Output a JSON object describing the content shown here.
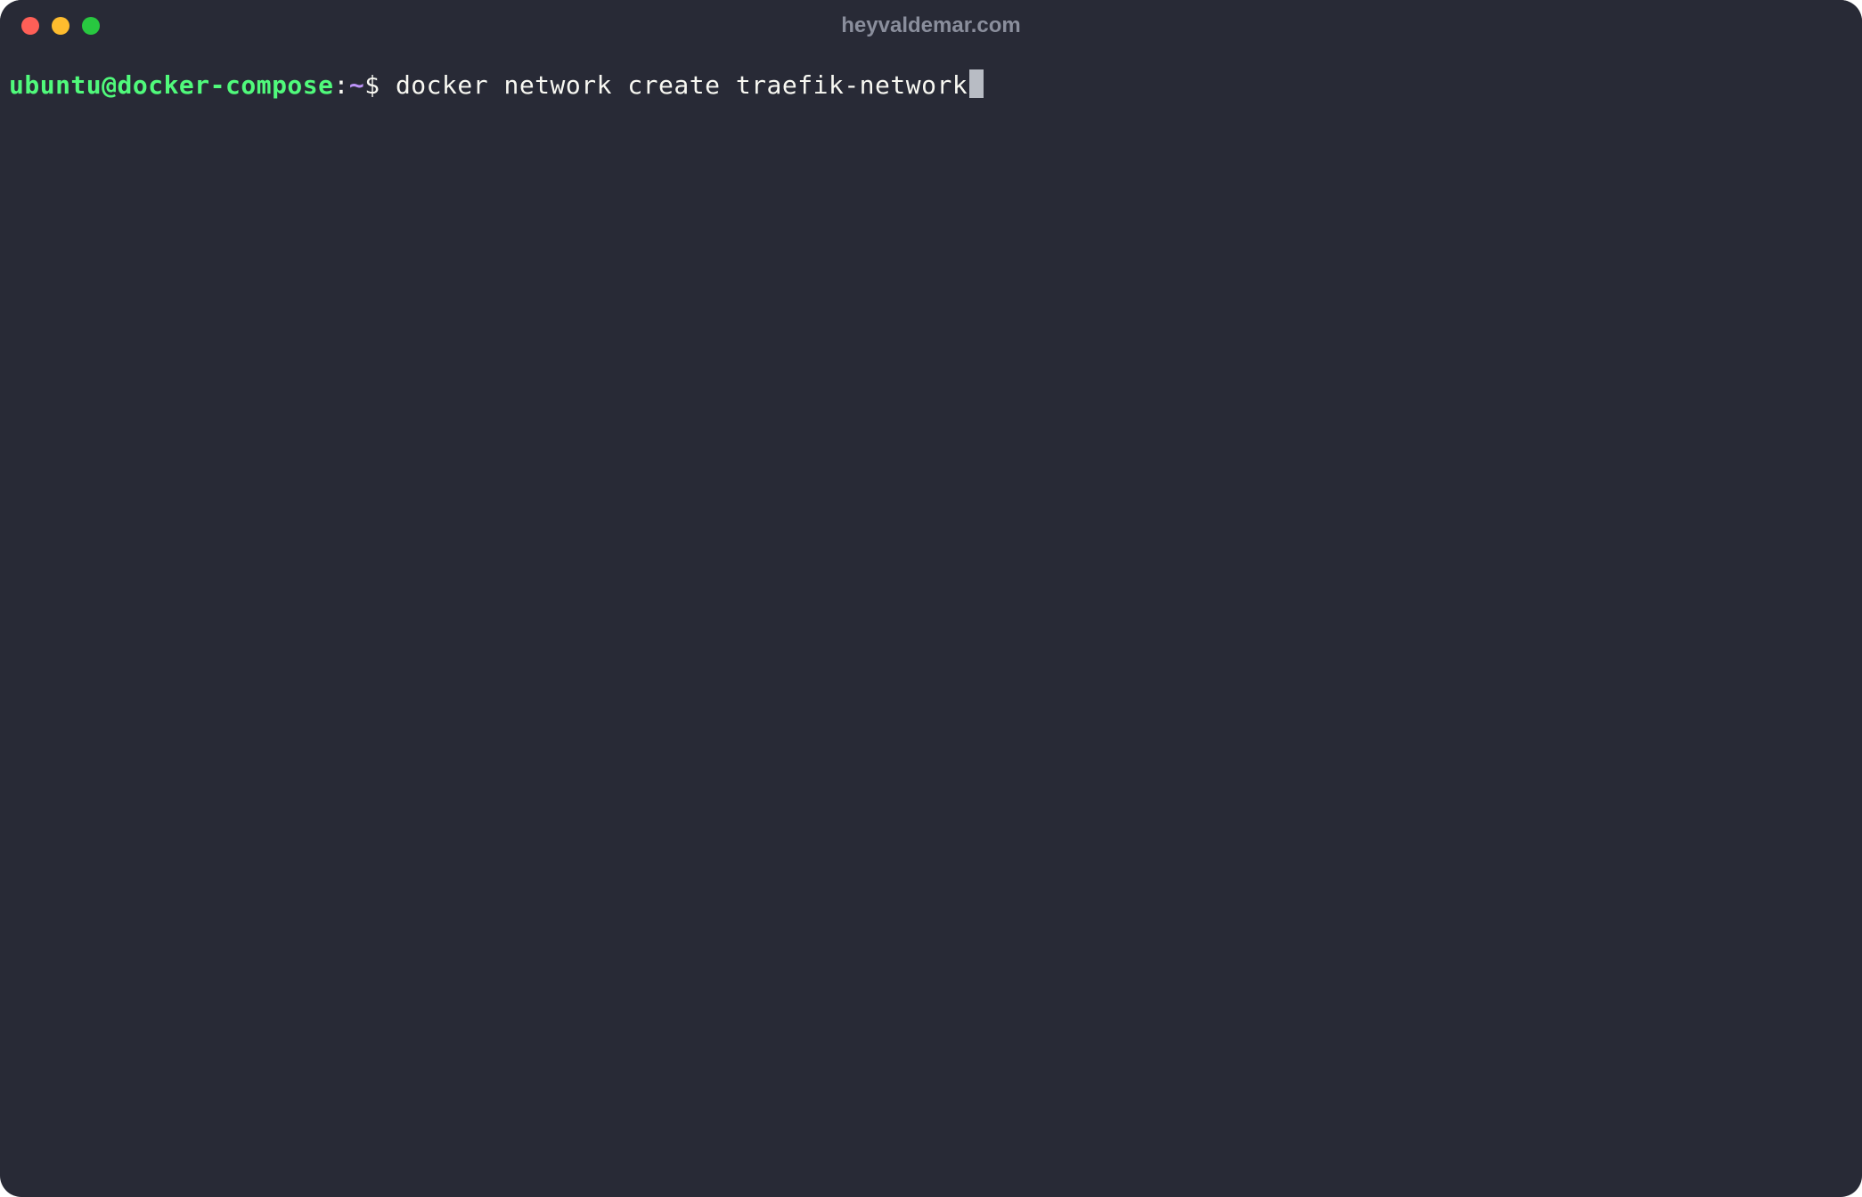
{
  "window": {
    "title": "heyvaldemar.com"
  },
  "terminal": {
    "prompt": {
      "user_host": "ubuntu@docker-compose",
      "colon": ":",
      "cwd": "~",
      "symbol": "$ "
    },
    "command": "docker network create traefik-network"
  },
  "colors": {
    "background": "#282a36",
    "foreground": "#f8f8f2",
    "green": "#50fa7b",
    "purple": "#bd93f9",
    "title_text": "#8a8e9c",
    "close_button": "#ff5f57",
    "minimize_button": "#febc2e",
    "maximize_button": "#28c840",
    "cursor": "#b8bcc4"
  }
}
